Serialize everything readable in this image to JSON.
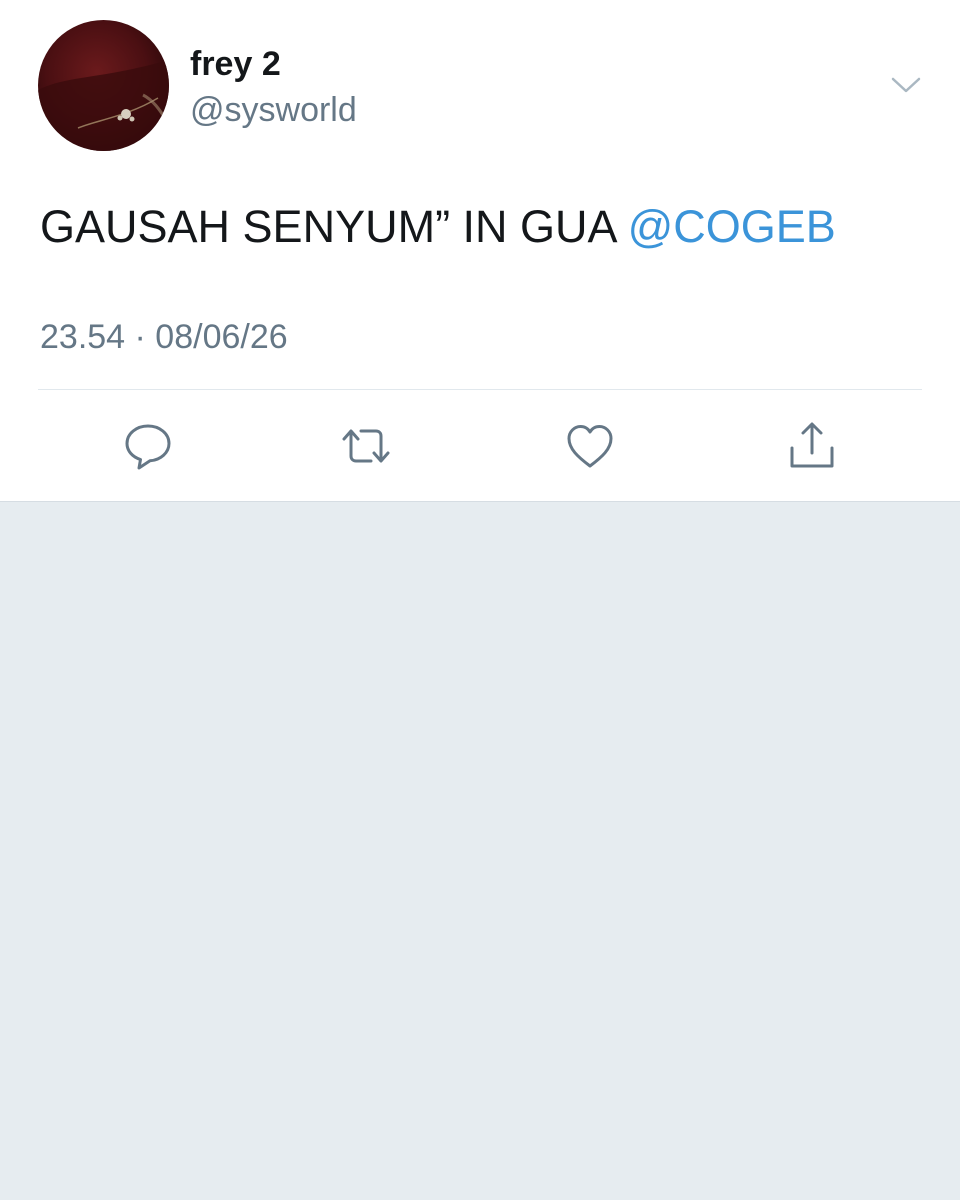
{
  "tweet": {
    "display_name": "frey 2",
    "handle": "@sysworld",
    "text": "GAUSAH SENYUM” IN GUA ",
    "mention": "@COGEB",
    "timestamp": "23.54 · 08/06/26"
  },
  "icons": {
    "caret": "chevron-down-icon",
    "reply": "reply-icon",
    "retweet": "retweet-icon",
    "like": "heart-icon",
    "share": "share-icon"
  },
  "colors": {
    "mention": "#3b94d9",
    "secondary_text": "#657786",
    "page_background": "#e6ecf0"
  }
}
